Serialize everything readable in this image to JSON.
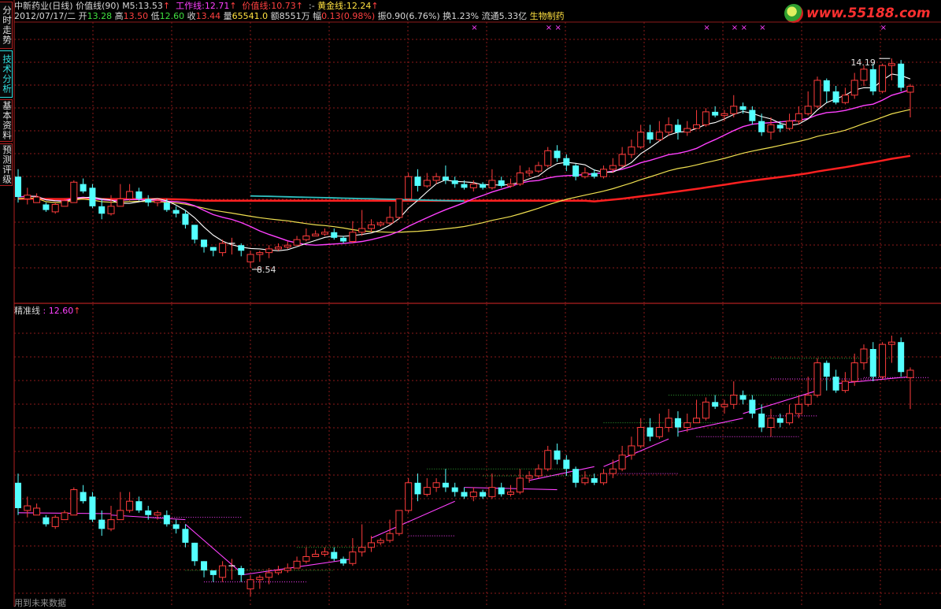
{
  "side_tabs": [
    {
      "label": "分时走势",
      "active": false
    },
    {
      "label": "技术分析",
      "active": true
    },
    {
      "label": "基本资料",
      "active": false
    },
    {
      "label": "预测评级",
      "active": false
    }
  ],
  "header": {
    "stock_name": "中新药业(日线)",
    "indicator": "价值线(90)",
    "m5_label": "M5:",
    "m5_value": "13.53",
    "work_label": "工作线:",
    "work_value": "12.71",
    "value_label": "价值线:",
    "value_value": "10.73",
    "gold_prefix": ":-",
    "gold_label": "黄金线:",
    "gold_value": "12.24",
    "date": "2012/07/17/二",
    "open_label": "开",
    "open": "13.28",
    "high_label": "高",
    "high": "13.50",
    "low_label": "低",
    "low": "12.60",
    "close_label": "收",
    "close": "13.44",
    "vol_label": "量",
    "vol": "65541.0",
    "amount_label": "额",
    "amount": "8551万",
    "chg_label": "幅",
    "chg": "0.13(0.98%)",
    "amp_label": "振",
    "amp": "0.90(6.76%)",
    "turn_label": "换",
    "turn": "1.23%",
    "float_label": "流通",
    "float": "5.33亿",
    "industry": "生物制药",
    "arrow": "↑"
  },
  "lower_header": {
    "label": "精准线",
    "value": ": 12.60",
    "arrow": "↑"
  },
  "logo": {
    "text": "www.55188.com"
  },
  "footnote": "用到未来数据",
  "colors": {
    "up": "#ff3c3c",
    "down": "#54ffff",
    "ma5": "#ffffff",
    "ma_m": "#ff40ff",
    "ma_y": "#f0e050",
    "ma_red": "#ff2020",
    "ma_cyan": "#30c0c0",
    "grid": "#8b1a1a",
    "precise": "#ff40ff",
    "level": "#30a030"
  },
  "chart_data": {
    "type": "candlestick",
    "ylim": [
      7.9,
      15.3
    ],
    "annotations": [
      {
        "text": "14.19",
        "kind": "high"
      },
      {
        "text": "8.54",
        "kind": "low"
      }
    ],
    "x_markers": [
      49,
      57,
      58,
      74,
      77,
      78,
      80,
      93
    ],
    "candles": [
      [
        11.0,
        10.45,
        11.2,
        10.3
      ],
      [
        10.4,
        10.5,
        10.7,
        10.25
      ],
      [
        10.3,
        10.45,
        10.55,
        10.3
      ],
      [
        10.25,
        10.1,
        10.3,
        10.05
      ],
      [
        10.05,
        10.25,
        10.3,
        10.0
      ],
      [
        10.2,
        10.35,
        10.4,
        10.2
      ],
      [
        10.3,
        10.85,
        10.9,
        10.3
      ],
      [
        10.8,
        10.6,
        10.95,
        10.55
      ],
      [
        10.7,
        10.2,
        10.8,
        10.15
      ],
      [
        10.2,
        10.0,
        10.4,
        9.85
      ],
      [
        10.0,
        10.2,
        10.5,
        9.95
      ],
      [
        10.2,
        10.4,
        10.8,
        10.2
      ],
      [
        10.4,
        10.6,
        10.8,
        10.35
      ],
      [
        10.6,
        10.4,
        10.7,
        10.35
      ],
      [
        10.4,
        10.3,
        10.5,
        10.2
      ],
      [
        10.3,
        10.35,
        10.4,
        10.2
      ],
      [
        10.3,
        10.1,
        10.4,
        10.05
      ],
      [
        10.1,
        10.0,
        10.2,
        9.9
      ],
      [
        10.0,
        9.7,
        10.1,
        9.6
      ],
      [
        9.7,
        9.3,
        9.7,
        9.2
      ],
      [
        9.3,
        9.1,
        9.3,
        8.95
      ],
      [
        9.1,
        9.0,
        9.1,
        8.85
      ],
      [
        8.95,
        9.2,
        9.3,
        8.85
      ],
      [
        9.2,
        9.2,
        9.35,
        8.9
      ],
      [
        9.15,
        9.0,
        9.2,
        8.85
      ],
      [
        8.7,
        8.9,
        9.0,
        8.54
      ],
      [
        8.9,
        8.95,
        9.0,
        8.7
      ],
      [
        8.95,
        9.05,
        9.15,
        8.8
      ],
      [
        9.05,
        9.1,
        9.2,
        9.0
      ],
      [
        9.1,
        9.15,
        9.25,
        9.05
      ],
      [
        9.15,
        9.3,
        9.4,
        9.15
      ],
      [
        9.3,
        9.4,
        9.6,
        9.25
      ],
      [
        9.4,
        9.45,
        9.55,
        9.4
      ],
      [
        9.45,
        9.5,
        9.6,
        9.4
      ],
      [
        9.5,
        9.35,
        9.6,
        9.3
      ],
      [
        9.35,
        9.25,
        9.4,
        9.2
      ],
      [
        9.25,
        9.5,
        9.8,
        9.2
      ],
      [
        9.5,
        9.6,
        10.1,
        9.4
      ],
      [
        9.6,
        9.7,
        9.85,
        9.5
      ],
      [
        9.7,
        9.75,
        9.8,
        9.65
      ],
      [
        9.75,
        9.9,
        10.2,
        9.7
      ],
      [
        9.9,
        10.4,
        10.4,
        9.85
      ],
      [
        10.4,
        11.0,
        11.1,
        10.35
      ],
      [
        11.0,
        10.75,
        11.2,
        10.6
      ],
      [
        10.75,
        10.9,
        11.1,
        10.7
      ],
      [
        10.9,
        11.0,
        11.1,
        10.8
      ],
      [
        11.0,
        10.9,
        11.3,
        10.8
      ],
      [
        10.9,
        10.8,
        11.0,
        10.7
      ],
      [
        10.8,
        10.7,
        10.9,
        10.65
      ],
      [
        10.7,
        10.8,
        10.9,
        10.6
      ],
      [
        10.8,
        10.7,
        10.85,
        10.65
      ],
      [
        10.7,
        10.9,
        11.2,
        10.65
      ],
      [
        10.9,
        10.75,
        11.0,
        10.7
      ],
      [
        10.75,
        10.8,
        10.95,
        10.7
      ],
      [
        10.8,
        11.1,
        11.3,
        10.75
      ],
      [
        11.1,
        11.15,
        11.25,
        11.0
      ],
      [
        11.15,
        11.3,
        11.4,
        11.1
      ],
      [
        11.3,
        11.7,
        11.8,
        11.25
      ],
      [
        11.7,
        11.5,
        11.85,
        11.4
      ],
      [
        11.5,
        11.3,
        11.6,
        11.15
      ],
      [
        11.3,
        11.0,
        11.35,
        10.9
      ],
      [
        11.0,
        11.1,
        11.25,
        10.95
      ],
      [
        11.1,
        11.0,
        11.2,
        10.95
      ],
      [
        11.0,
        11.2,
        11.3,
        10.95
      ],
      [
        11.2,
        11.3,
        11.5,
        11.1
      ],
      [
        11.3,
        11.6,
        11.8,
        11.25
      ],
      [
        11.6,
        11.8,
        12.0,
        11.5
      ],
      [
        11.8,
        12.2,
        12.4,
        11.75
      ],
      [
        12.2,
        12.0,
        12.4,
        11.9
      ],
      [
        12.0,
        12.2,
        12.5,
        11.95
      ],
      [
        12.2,
        12.4,
        12.6,
        12.1
      ],
      [
        12.4,
        12.2,
        12.55,
        12.0
      ],
      [
        12.2,
        12.3,
        12.5,
        12.1
      ],
      [
        12.3,
        12.4,
        12.8,
        12.3
      ],
      [
        12.4,
        12.75,
        12.85,
        12.35
      ],
      [
        12.75,
        12.65,
        12.9,
        12.6
      ],
      [
        12.65,
        12.7,
        12.8,
        12.5
      ],
      [
        12.7,
        12.9,
        13.2,
        12.6
      ],
      [
        12.9,
        12.8,
        13.0,
        12.7
      ],
      [
        12.8,
        12.5,
        12.9,
        12.4
      ],
      [
        12.5,
        12.2,
        12.7,
        12.1
      ],
      [
        12.2,
        12.4,
        12.6,
        12.0
      ],
      [
        12.4,
        12.3,
        12.5,
        12.2
      ],
      [
        12.3,
        12.5,
        12.7,
        12.25
      ],
      [
        12.5,
        12.7,
        12.9,
        12.4
      ],
      [
        12.7,
        12.9,
        13.3,
        12.65
      ],
      [
        12.9,
        13.6,
        13.7,
        12.85
      ],
      [
        13.6,
        13.3,
        13.65,
        13.0
      ],
      [
        13.3,
        13.0,
        13.45,
        12.95
      ],
      [
        13.0,
        13.2,
        13.4,
        12.95
      ],
      [
        13.2,
        13.6,
        13.8,
        13.1
      ],
      [
        13.6,
        13.9,
        14.0,
        13.45
      ],
      [
        13.9,
        13.3,
        14.05,
        13.2
      ],
      [
        13.3,
        14.0,
        14.05,
        13.25
      ],
      [
        14.0,
        14.05,
        14.19,
        13.6
      ],
      [
        14.05,
        13.4,
        14.15,
        13.3
      ],
      [
        13.28,
        13.44,
        13.5,
        12.6
      ]
    ]
  }
}
